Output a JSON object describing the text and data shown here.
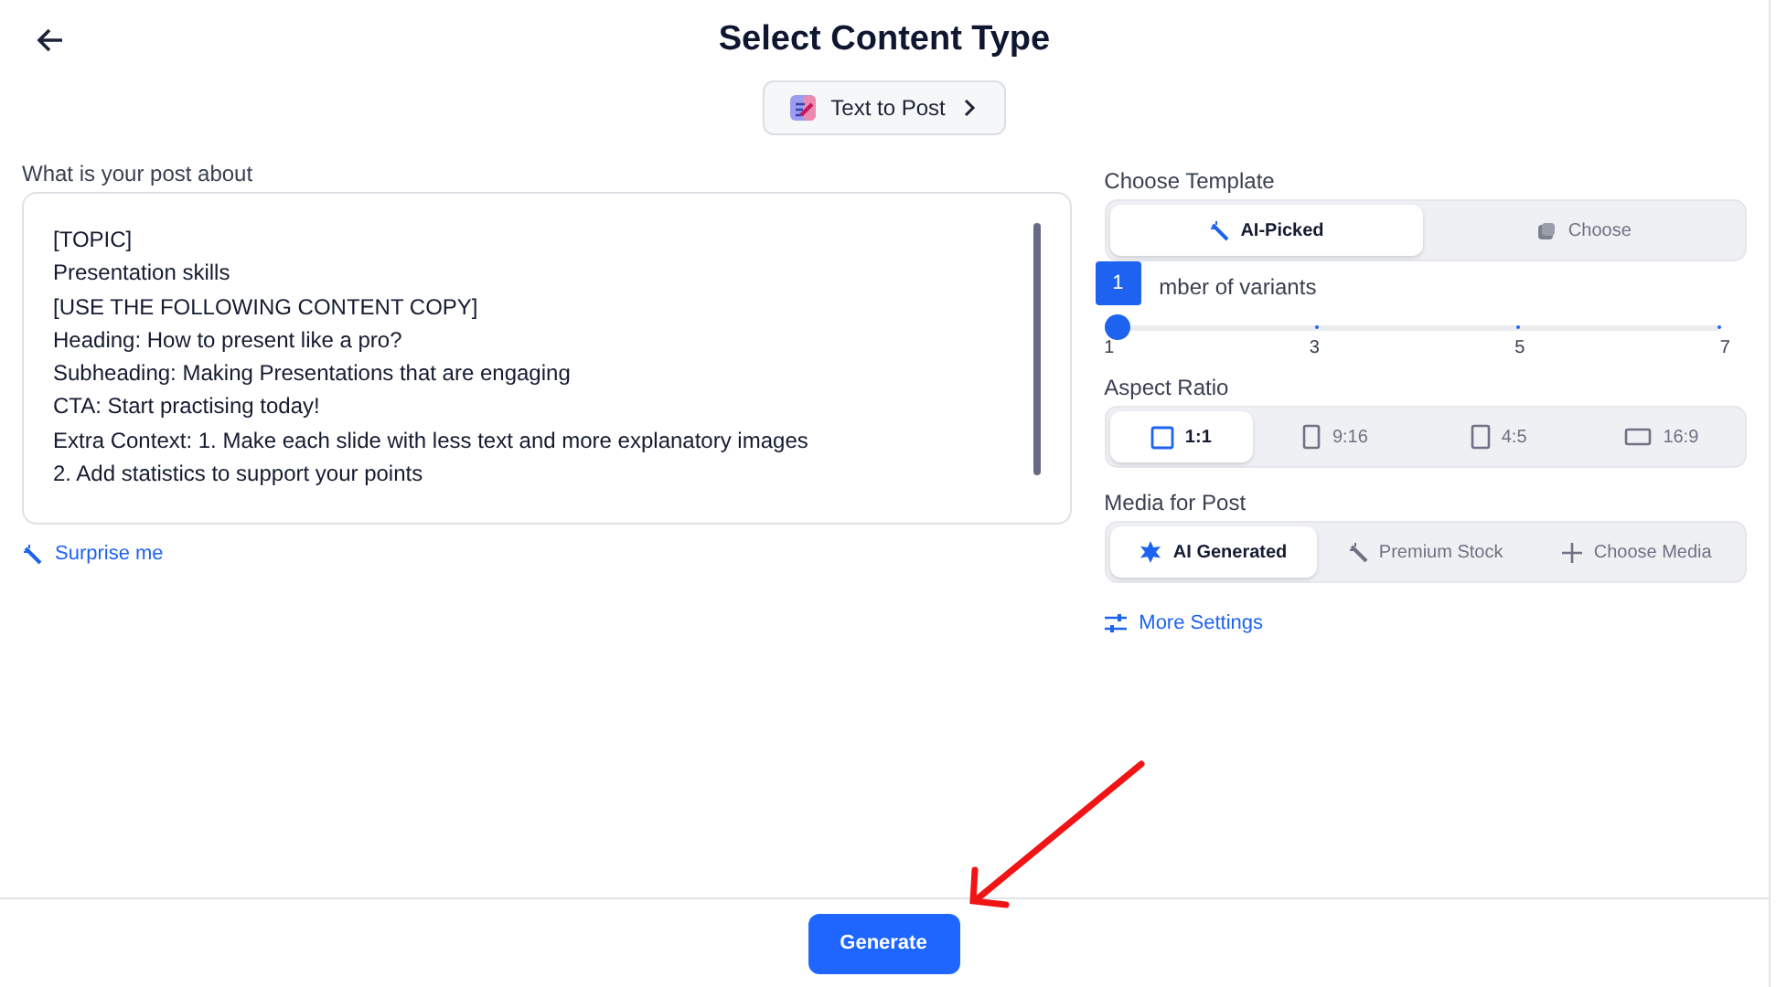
{
  "header": {
    "title": "Select Content Type"
  },
  "content_type_button": {
    "label": "Text to Post"
  },
  "post_prompt": {
    "label": "What is your post about",
    "lines": [
      "[TOPIC]",
      "Presentation skills",
      "[USE THE FOLLOWING CONTENT COPY]",
      "Heading: How to present like a pro?",
      "Subheading: Making Presentations that are engaging",
      "CTA: Start practising today!",
      "Extra Context: 1. Make each slide with less text and more explanatory images",
      "2. Add statistics to support your points"
    ]
  },
  "surprise_link": {
    "label": "Surprise me"
  },
  "template": {
    "label": "Choose Template",
    "options": [
      {
        "label": "AI-Picked",
        "kind": "wand",
        "selected": true
      },
      {
        "label": "Choose",
        "kind": "stack",
        "selected": false
      }
    ]
  },
  "variants": {
    "label": "mber of variants",
    "level": 0,
    "tooltip": "1",
    "ticks": [
      "1",
      "3",
      "5",
      "7"
    ]
  },
  "aspect_ratio": {
    "label": "Aspect Ratio",
    "options": [
      {
        "label": "1:1",
        "kind": "square",
        "selected": true
      },
      {
        "label": "9:16",
        "kind": "tall",
        "selected": false
      },
      {
        "label": "4:5",
        "kind": "portrait",
        "selected": false
      },
      {
        "label": "16:9",
        "kind": "wide",
        "selected": false
      }
    ]
  },
  "media": {
    "label": "Media for Post",
    "options": [
      {
        "label": "AI Generated",
        "kind": "sparkle",
        "selected": true
      },
      {
        "label": "Premium Stock",
        "kind": "wand",
        "selected": false
      },
      {
        "label": "Choose Media",
        "kind": "plus",
        "selected": false
      }
    ]
  },
  "more_settings": {
    "label": "More Settings"
  },
  "generate_button": {
    "label": "Generate"
  }
}
